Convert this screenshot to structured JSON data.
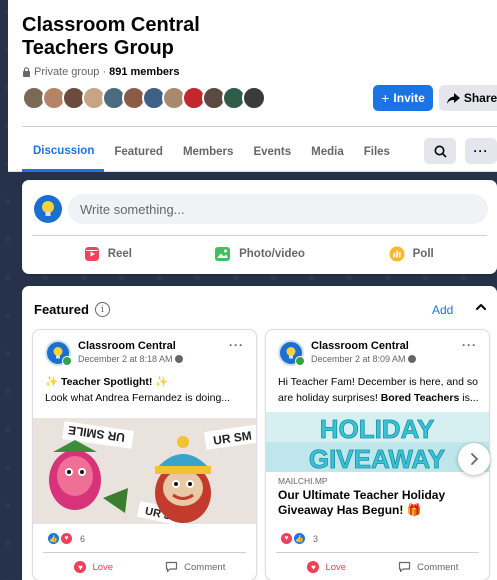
{
  "group": {
    "title": "Classroom Central Teachers Group",
    "privacy": "Private group",
    "separator": "·",
    "members": "891 members"
  },
  "buttons": {
    "invite": "Invite",
    "share": "Share",
    "invite_icon": "plus-icon",
    "share_icon": "share-arrow-icon"
  },
  "tabs": [
    "Discussion",
    "Featured",
    "Members",
    "Events",
    "Media",
    "Files"
  ],
  "active_tab": "Discussion",
  "composer": {
    "placeholder": "Write something...",
    "actions": [
      {
        "label": "Reel",
        "icon": "reel-icon",
        "color": "#f3425f"
      },
      {
        "label": "Photo/video",
        "icon": "photo-icon",
        "color": "#45bd62"
      },
      {
        "label": "Poll",
        "icon": "poll-icon",
        "color": "#f7b928"
      }
    ]
  },
  "featured": {
    "title": "Featured",
    "add_label": "Add",
    "posts": [
      {
        "author": "Classroom Central",
        "date": "December 2 at 8:18 AM",
        "line1": "Teacher Spotlight!",
        "line2": "Look what Andrea Fernandez is doing...",
        "image_text_1": "UR SMILE",
        "image_text_2": "UR SM",
        "image_text_3": "UR S",
        "reaction_count": "6",
        "love_label": "Love",
        "comment_label": "Comment"
      },
      {
        "author": "Classroom Central",
        "date": "December 2 at 8:09 AM",
        "text_a": "Hi Teacher Fam! December is here, and so are holiday surprises! ",
        "text_b": "Bored Teachers",
        "text_c": " is...",
        "image_text_1": "HOLIDAY",
        "image_text_2": "GIVEAWAY",
        "link_domain": "MAILCHI.MP",
        "link_title": "Our Ultimate Teacher Holiday Giveaway Has Begun!",
        "reaction_count": "3",
        "love_label": "Love",
        "comment_label": "Comment"
      }
    ]
  },
  "colors": {
    "accent": "#1b74e4",
    "love": "#f33e58",
    "online": "#31a24c"
  }
}
